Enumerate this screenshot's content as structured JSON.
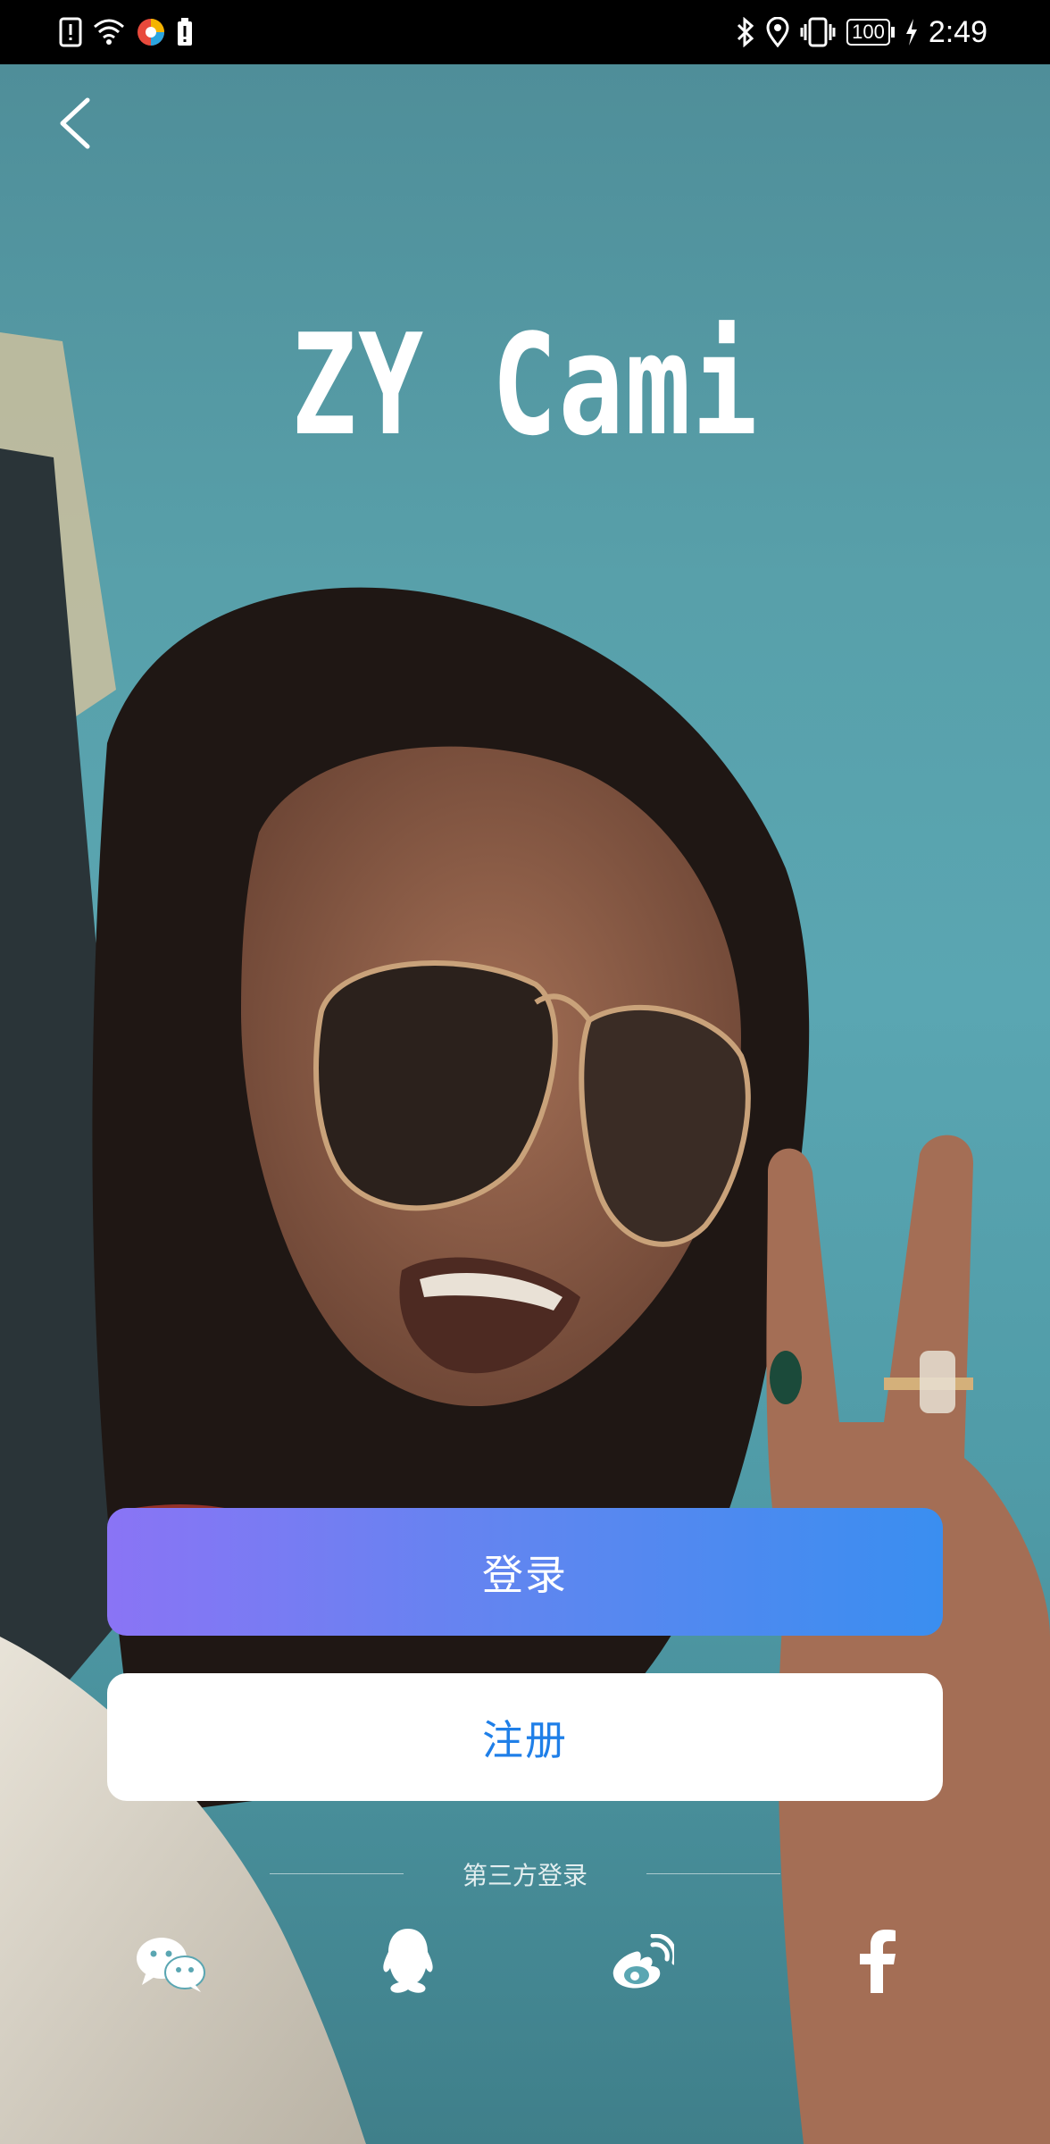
{
  "status_bar": {
    "time": "2:49",
    "battery_level": "100",
    "left_icons": [
      "alert-icon",
      "wifi-icon",
      "app-notification-icon",
      "battery-saver-icon"
    ],
    "right_icons": [
      "bluetooth-icon",
      "location-icon",
      "vibrate-icon"
    ]
  },
  "header": {
    "app_name": "ZY Cami"
  },
  "actions": {
    "login_label": "登录",
    "register_label": "注册"
  },
  "third_party": {
    "label": "第三方登录",
    "providers": [
      "wechat-icon",
      "qq-icon",
      "weibo-icon",
      "facebook-icon"
    ]
  },
  "colors": {
    "login_gradient_start": "#8a74f5",
    "login_gradient_end": "#3a8ef0",
    "register_text": "#1f7fe8"
  }
}
